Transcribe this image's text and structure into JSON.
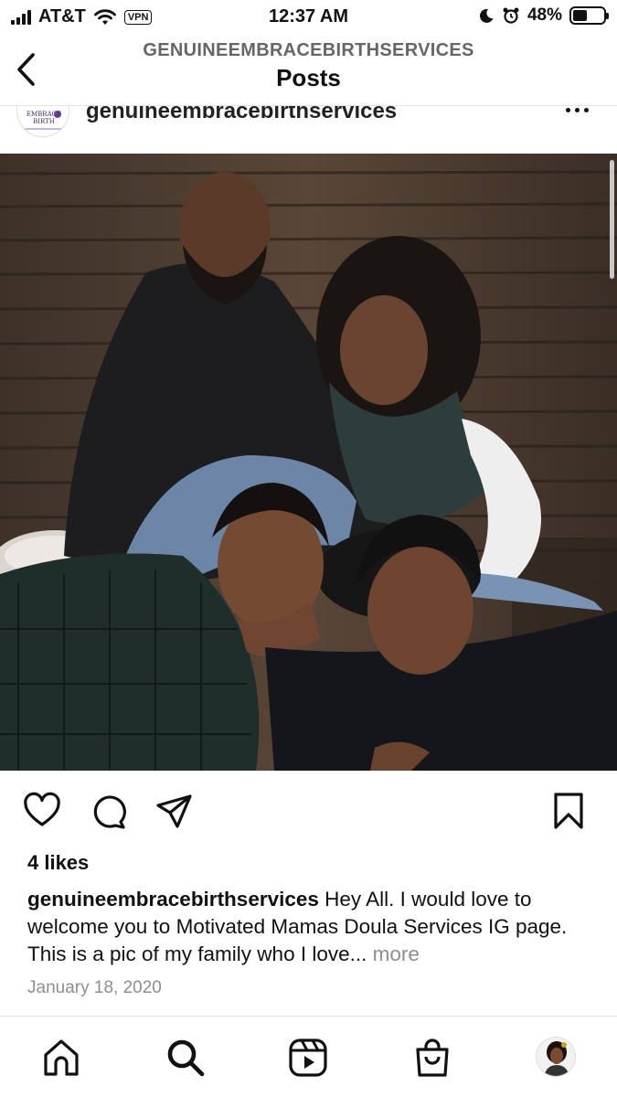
{
  "status_bar": {
    "carrier": "AT&T",
    "vpn_label": "VPN",
    "time": "12:37 AM",
    "battery_percent": "48%",
    "battery_level": 0.48
  },
  "header": {
    "account_name": "GENUINEEMBRACEBIRTHSERVICES",
    "title": "Posts"
  },
  "post": {
    "username": "genuineembracebirthservices",
    "logo_text": "EMBRACE BIRTH",
    "likes": "4 likes",
    "caption_user": "genuineembracebirthservices",
    "caption_text": " Hey All. I would love to welcome you to Motivated Mamas Doula Services IG page. This is a pic of my family who I love...",
    "caption_more": " more",
    "date": "January 18, 2020"
  },
  "icons": {
    "back": "chevron-left-icon",
    "more": "ellipsis-icon",
    "like": "heart-icon",
    "comment": "comment-icon",
    "share": "paper-plane-icon",
    "save": "bookmark-icon",
    "home": "home-icon",
    "search": "search-icon",
    "reels": "reels-icon",
    "shop": "shopping-bag-icon"
  }
}
